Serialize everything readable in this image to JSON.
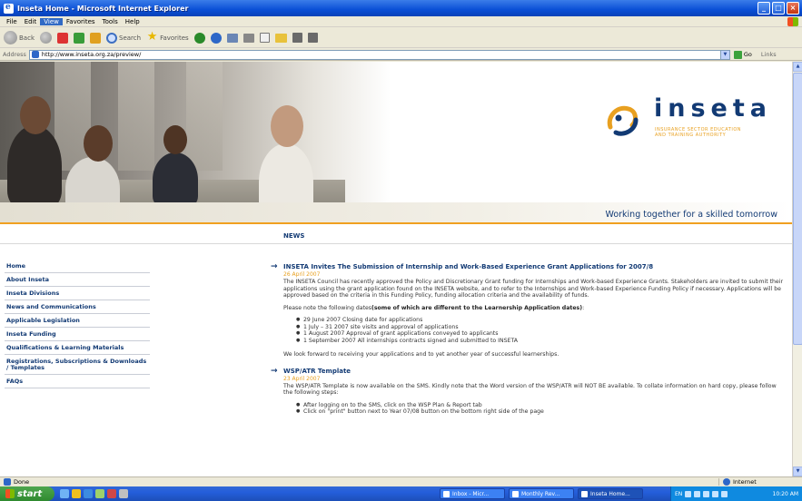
{
  "window": {
    "title": "Inseta Home - Microsoft Internet Explorer",
    "menu": [
      "File",
      "Edit",
      "View",
      "Favorites",
      "Tools",
      "Help"
    ],
    "active_menu": "View"
  },
  "toolbar": {
    "back_label": "Back",
    "search_label": "Search",
    "favorites_label": "Favorites"
  },
  "address": {
    "label": "Address",
    "url": "http://www.inseta.org.za/preview/",
    "go_label": "Go",
    "links_label": "Links"
  },
  "site": {
    "logo_text": "inseta",
    "logo_sub_line1": "INSURANCE SECTOR EDUCATION",
    "logo_sub_line2": "AND TRAINING AUTHORITY",
    "tagline": "Working together for a skilled tomorrow",
    "section_header": "NEWS"
  },
  "sidebar": {
    "items": [
      "Home",
      "About Inseta",
      "Inseta Divisions",
      "News and Communications",
      "Applicable Legislation",
      "Inseta Funding",
      "Qualifications & Learning Materials",
      "Registrations, Subscriptions & Downloads / Templates",
      "FAQs"
    ]
  },
  "articles": [
    {
      "title": "INSETA Invites The Submission of Internship and Work-Based Experience Grant Applications for 2007/8",
      "date": "26 April 2007",
      "body": "The INSETA Council has recently approved the Policy and Discretionary Grant funding for Internships and Work-based Experience Grants. Stakeholders are invited to submit their applications using the grant application found on the INSETA website, and to refer to the Internships and Work-based Experience Funding Policy if necessary. Applications will be approved based on the criteria in this Funding Policy, funding allocation criteria and the availability of funds.",
      "note_prefix": "Please note the following dates",
      "note_bold": "(some of which are different to the Learnership Application dates)",
      "note_suffix": ":",
      "bullets": [
        "29 June 2007 Closing date for applications",
        "1 July – 31 2007 site visits and approval of applications",
        "1 August 2007 Approval of grant applications conveyed to applicants",
        "1 September 2007 All internships contracts signed and submitted to INSETA"
      ],
      "closing": "We look forward to receiving your applications and to yet another year of successful learnerships."
    },
    {
      "title": "WSP/ATR Template",
      "date": "23 April 2007",
      "body": "The WSP/ATR Template is now available on the SMS. Kindly note that the Word version of the WSP/ATR will NOT BE available. To collate information on hard copy, please follow the following steps:",
      "bullets": [
        "After logging on to the SMS, click on the WSP Plan & Report tab",
        "Click on \"print\" button next to Year 07/08 button on the bottom right side of the page"
      ]
    }
  ],
  "statusbar": {
    "status": "Done",
    "zone": "Internet"
  },
  "taskbar": {
    "start_label": "start",
    "tasks": [
      "Inbox - Micr...",
      "Monthly Rev...",
      "Inseta Home..."
    ],
    "lang": "EN",
    "clock": "10:20 AM"
  }
}
